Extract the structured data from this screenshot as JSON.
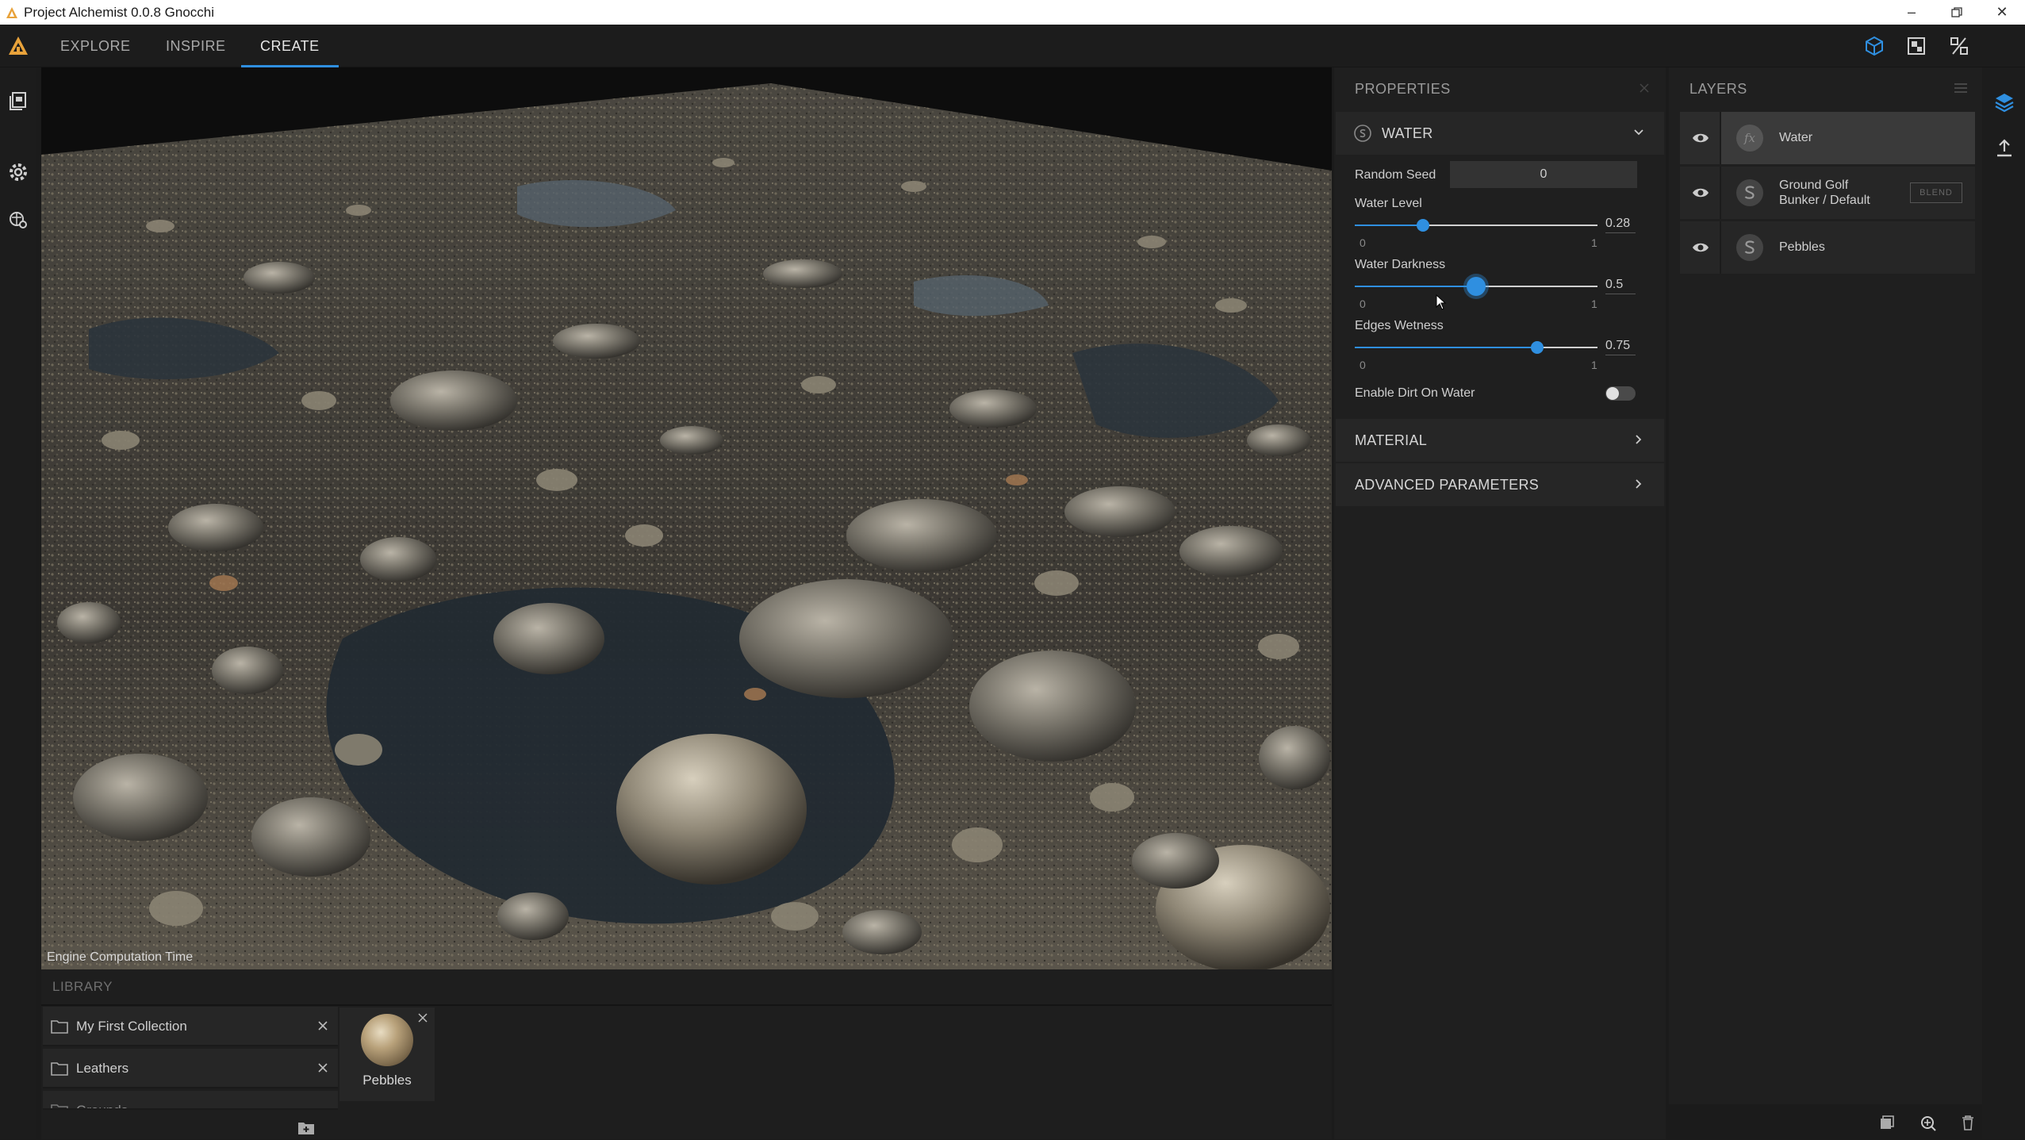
{
  "window": {
    "title": "Project Alchemist 0.0.8 Gnocchi"
  },
  "nav": {
    "tabs": [
      "EXPLORE",
      "INSPIRE",
      "CREATE"
    ],
    "active_tab": "CREATE"
  },
  "viewport": {
    "engine_label": "Engine Computation Time"
  },
  "library": {
    "title": "LIBRARY",
    "collections": [
      {
        "name": "My First Collection"
      },
      {
        "name": "Leathers"
      },
      {
        "name": "Grounds"
      }
    ],
    "items": [
      {
        "name": "Pebbles"
      }
    ]
  },
  "properties": {
    "title": "PROPERTIES",
    "section": "WATER",
    "random_seed_label": "Random Seed",
    "random_seed_value": "0",
    "sliders": [
      {
        "label": "Water Level",
        "value": "0.28",
        "fraction": 0.28,
        "min": "0",
        "max": "1"
      },
      {
        "label": "Water Darkness",
        "value": "0.5",
        "fraction": 0.5,
        "min": "0",
        "max": "1"
      },
      {
        "label": "Edges Wetness",
        "value": "0.75",
        "fraction": 0.75,
        "min": "0",
        "max": "1"
      }
    ],
    "toggle_label": "Enable Dirt On Water",
    "toggle_on": false,
    "material_label": "MATERIAL",
    "advanced_label": "ADVANCED PARAMETERS"
  },
  "layers": {
    "title": "LAYERS",
    "items": [
      {
        "name": "Water",
        "icon": "fx-icon",
        "selected": true
      },
      {
        "name_line1": "Ground Golf",
        "name_line2": "Bunker / Default",
        "icon": "substance-icon",
        "blend": "BLEND"
      },
      {
        "name": "Pebbles",
        "icon": "substance-icon"
      }
    ]
  },
  "colors": {
    "accent": "#2f8fe0",
    "panel": "#1f1f1f",
    "background": "#1b1b1b"
  }
}
